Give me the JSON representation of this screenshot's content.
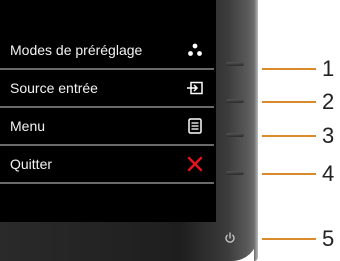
{
  "osd": {
    "items": [
      {
        "label": "Modes de préréglage",
        "icon": "preset-modes-icon"
      },
      {
        "label": "Source entrée",
        "icon": "input-source-icon"
      },
      {
        "label": "Menu",
        "icon": "menu-icon"
      },
      {
        "label": "Quitter",
        "icon": "exit-x-icon"
      }
    ]
  },
  "callouts": [
    "1",
    "2",
    "3",
    "4",
    "5"
  ],
  "colors": {
    "callout_line": "#d98a2a",
    "exit_x": "#e0141e",
    "osd_text": "#f2f2f2"
  }
}
